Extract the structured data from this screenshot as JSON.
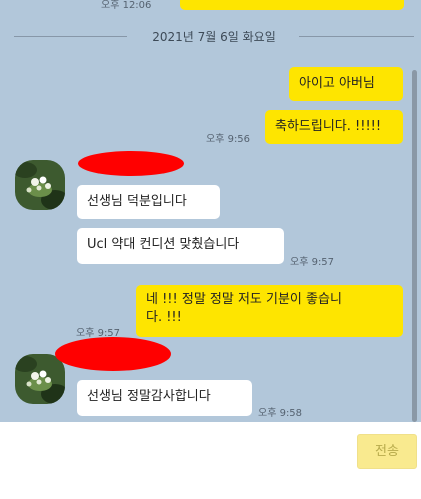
{
  "chat": {
    "top_partial": {
      "time": "오후 12:06"
    },
    "date_separator": "2021년 7월 6일 화요일",
    "messages": [
      {
        "id": "m1",
        "sender": "me",
        "text": "아이고 아버님"
      },
      {
        "id": "m2",
        "sender": "me",
        "text": "축하드립니다. !!!!!",
        "time": "오후 9:56"
      },
      {
        "id": "m3",
        "sender": "other",
        "text": "선생님 덕분입니다"
      },
      {
        "id": "m4",
        "sender": "other",
        "text": "Ucl 약대 컨디션 맞췄습니다",
        "time": "오후 9:57"
      },
      {
        "id": "m5",
        "sender": "me",
        "text_line1": "네 !!! 정말 정말 저도 기분이 좋습니",
        "text_line2": "다. !!!",
        "time": "오후 9:57"
      },
      {
        "id": "m6",
        "sender": "other",
        "text": "선생님 정말감사합니다",
        "time": "오후 9:58"
      }
    ]
  },
  "footer": {
    "send_label": "전송"
  },
  "colors": {
    "background": "#b2c7da",
    "my_bubble": "#fee500",
    "other_bubble": "#ffffff",
    "redaction": "#ff0000"
  },
  "icons": {
    "avatar": "profile-photo-flowers"
  }
}
